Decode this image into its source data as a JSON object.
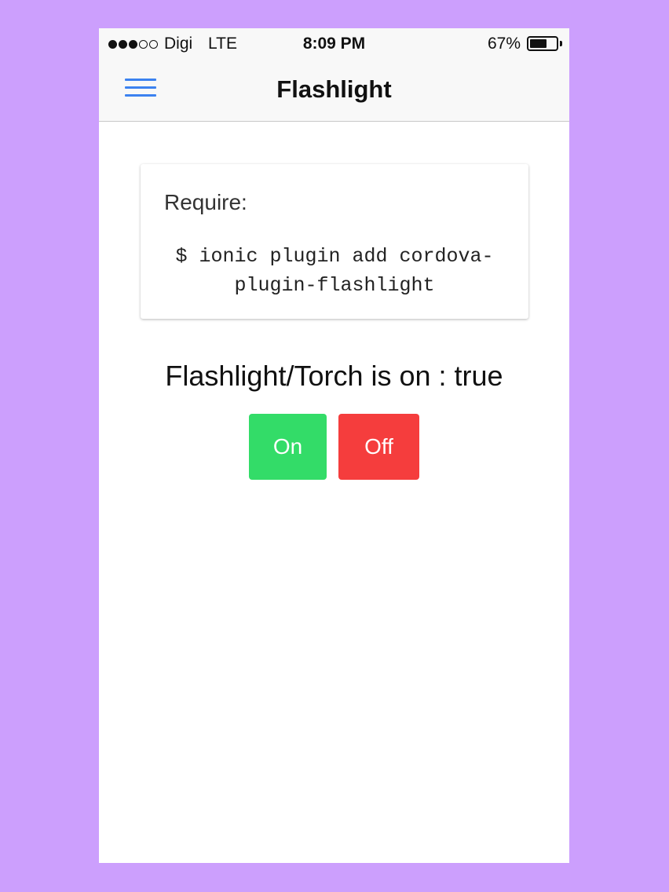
{
  "colors": {
    "background": "#cc9ffd",
    "accent": "#3c82f0",
    "on_button": "#33dc68",
    "off_button": "#f53d3d"
  },
  "status_bar": {
    "carrier": "Digi",
    "network": "LTE",
    "time": "8:09 PM",
    "battery": "67%",
    "battery_level": 0.67,
    "signal_bars_filled": 3,
    "signal_bars_total": 5
  },
  "header": {
    "menu_icon": "hamburger-menu-icon",
    "title": "Flashlight"
  },
  "card": {
    "title": "Require:",
    "code": "$ ionic plugin add cordova-plugin-flashlight"
  },
  "main": {
    "status_text": "Flashlight/Torch is on : true",
    "on_label": "On",
    "off_label": "Off"
  }
}
